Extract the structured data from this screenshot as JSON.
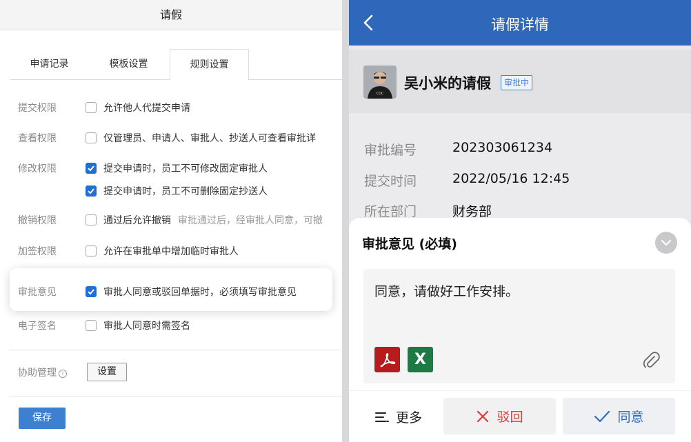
{
  "left": {
    "title": "请假",
    "tabs": [
      {
        "label": "申请记录",
        "active": false
      },
      {
        "label": "模板设置",
        "active": false
      },
      {
        "label": "规则设置",
        "active": true
      }
    ],
    "rules": {
      "submit": {
        "label": "提交权限",
        "options": [
          {
            "text": "允许他人代提交申请",
            "checked": false
          }
        ]
      },
      "view": {
        "label": "查看权限",
        "options": [
          {
            "text": "仅管理员、申请人、审批人、抄送人可查看审批详",
            "checked": false
          }
        ]
      },
      "modify": {
        "label": "修改权限",
        "options": [
          {
            "text": "提交申请时，员工不可修改固定审批人",
            "checked": true
          },
          {
            "text": "提交申请时，员工不可删除固定抄送人",
            "checked": true
          }
        ]
      },
      "revoke": {
        "label": "撤销权限",
        "options": [
          {
            "text": "通过后允许撤销",
            "checked": false,
            "hint": "审批通过后，经审批人同意，可撤"
          }
        ]
      },
      "addsign": {
        "label": "加签权限",
        "options": [
          {
            "text": "允许在审批单中增加临时审批人",
            "checked": false
          }
        ]
      },
      "opinion": {
        "label": "审批意见",
        "options": [
          {
            "text": "审批人同意或驳回单据时，必须填写审批意见",
            "checked": true
          }
        ]
      },
      "esign": {
        "label": "电子签名",
        "options": [
          {
            "text": "审批人同意时需签名",
            "checked": false
          }
        ]
      },
      "assist": {
        "label": "协助管理",
        "button": "设置"
      }
    },
    "save_label": "保存"
  },
  "right": {
    "header_title": "请假详情",
    "applicant": "吴小米的请假",
    "status_badge": "审批中",
    "info": [
      {
        "label": "审批编号",
        "value": "202303061234"
      },
      {
        "label": "提交时间",
        "value": "2022/05/16 12:45"
      },
      {
        "label": "所在部门",
        "value": "财务部"
      }
    ],
    "sheet": {
      "title": "审批意见 (必填)",
      "opinion": "同意，请做好工作安排。",
      "attachments": [
        {
          "type": "pdf",
          "icon": "pdf-file-icon",
          "color": "#b71c1c"
        },
        {
          "type": "excel",
          "icon": "excel-file-icon",
          "glyph": "X",
          "color": "#1e7a45"
        }
      ],
      "more_label": "更多",
      "reject_label": "驳回",
      "approve_label": "同意"
    },
    "colors": {
      "header": "#2f67bb",
      "reject": "#e03a3a",
      "approve": "#2f6bc4"
    }
  }
}
